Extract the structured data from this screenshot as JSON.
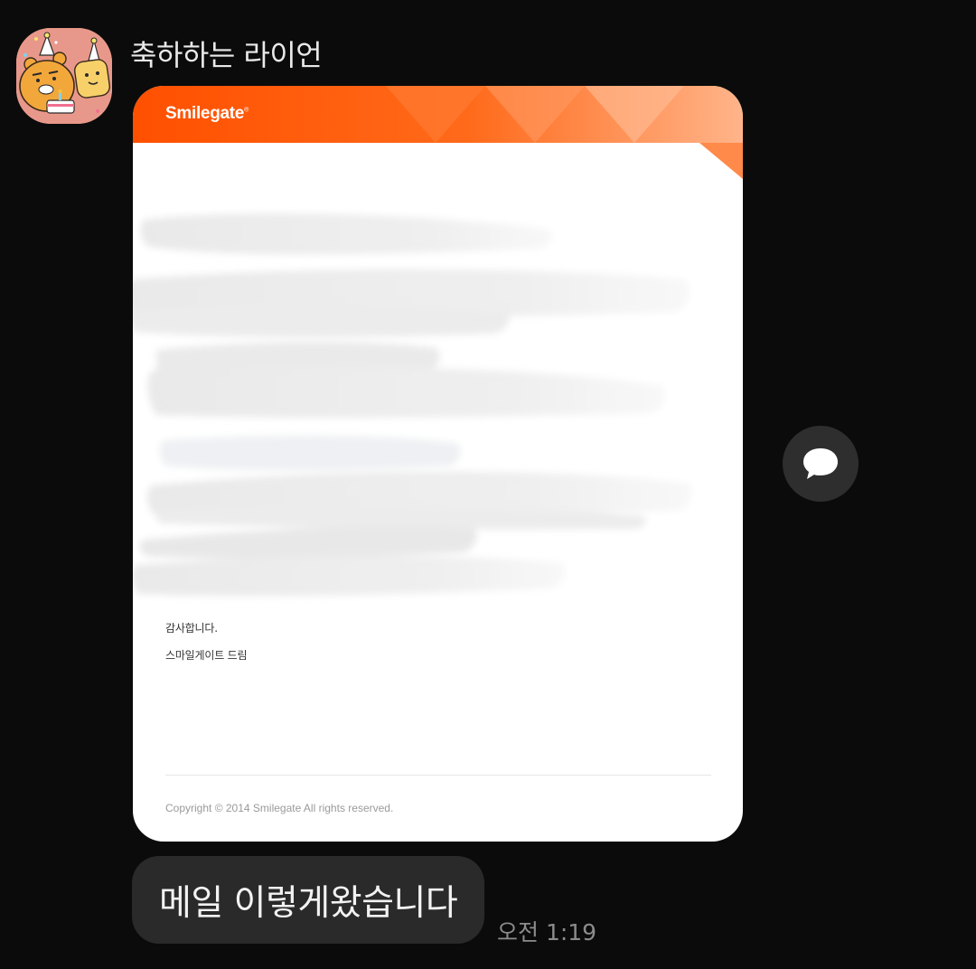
{
  "chat": {
    "sender_name": "축하하는 라이언",
    "avatar_icon": "ryan-character-icon",
    "reply_icon": "speech-bubble-icon"
  },
  "email_image": {
    "brand_logo": "Smilegate",
    "brand_color": "#ff5a00",
    "body_lines": [
      "감사합니다.",
      "스마일게이트 드림"
    ],
    "copyright": "Copyright © 2014 Smilegate All rights reserved."
  },
  "message": {
    "text": "메일 이렇게왔습니다",
    "time": "오전 1:19"
  }
}
